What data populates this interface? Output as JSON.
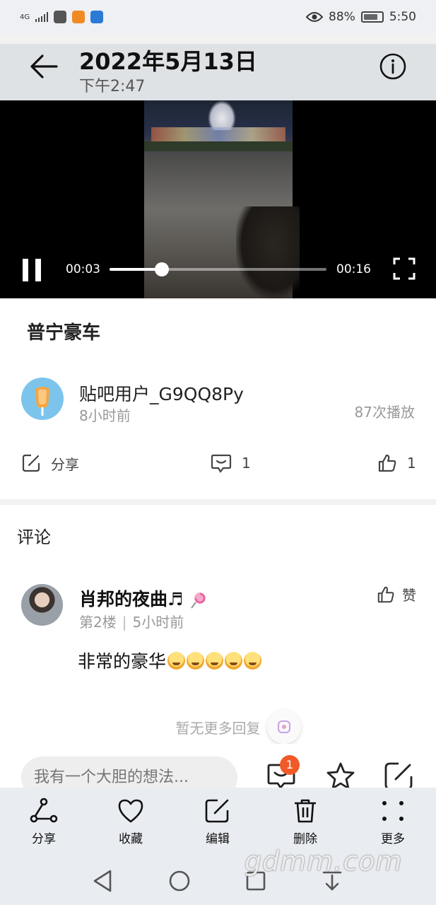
{
  "status_bar": {
    "network": "4G",
    "battery": "88%",
    "time": "5:50"
  },
  "header": {
    "date": "2022年5月13日",
    "time": "下午2:47"
  },
  "player": {
    "current_time": "00:03",
    "total_time": "00:16",
    "progress": 0.24
  },
  "post": {
    "title": "普宁豪车",
    "author": "贴吧用户_G9QQ8Py",
    "posted": "8小时前",
    "plays": "87次播放",
    "share_label": "分享",
    "comment_count": "1",
    "like_count": "1"
  },
  "comments": {
    "heading": "评论",
    "items": [
      {
        "name": "肖邦的夜曲♬",
        "floor": "第2楼",
        "time": "5小时前",
        "text": "非常的豪华",
        "like_label": "赞"
      }
    ],
    "no_more": "暂无更多回复"
  },
  "reply_bar": {
    "placeholder": "我有一个大胆的想法...",
    "badge": "1"
  },
  "bottom_actions": [
    {
      "label": "分享",
      "icon": "share-icon"
    },
    {
      "label": "收藏",
      "icon": "heart-icon"
    },
    {
      "label": "编辑",
      "icon": "edit-icon"
    },
    {
      "label": "删除",
      "icon": "trash-icon"
    },
    {
      "label": "更多",
      "icon": "more-icon"
    }
  ],
  "watermark": "gdmm.com"
}
